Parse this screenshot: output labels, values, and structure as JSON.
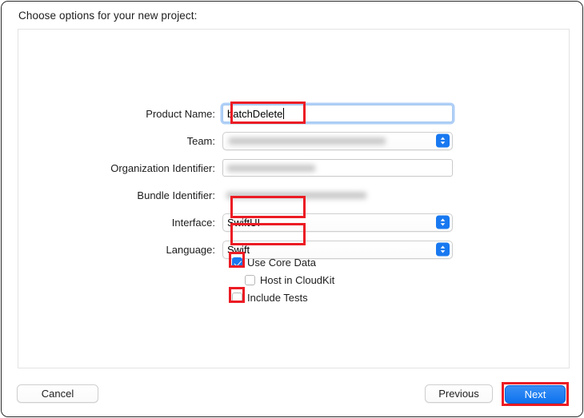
{
  "window": {
    "sheet_title": "Choose options for your new project:"
  },
  "form": {
    "rows": [
      {
        "label": "Product Name:",
        "type": "text",
        "value": "batchDelete",
        "redacted": false,
        "highlighted": true
      },
      {
        "label": "Team:",
        "type": "popup",
        "value": "",
        "redacted": true,
        "highlighted": false
      },
      {
        "label": "Organization Identifier:",
        "type": "plain",
        "value": "",
        "redacted": true,
        "highlighted": false
      },
      {
        "label": "Bundle Identifier:",
        "type": "readonly",
        "value": "",
        "redacted": true,
        "highlighted": false
      },
      {
        "label": "Interface:",
        "type": "popup",
        "value": "SwiftUI",
        "redacted": false,
        "highlighted": true
      },
      {
        "label": "Language:",
        "type": "popup",
        "value": "Swift",
        "redacted": false,
        "highlighted": true
      }
    ]
  },
  "options": {
    "use_core_data": {
      "label": "Use Core Data",
      "checked": true,
      "highlighted": true
    },
    "host_in_cloudkit": {
      "label": "Host in CloudKit",
      "checked": false,
      "highlighted": false
    },
    "include_tests": {
      "label": "Include Tests",
      "checked": false,
      "highlighted": true
    }
  },
  "footer": {
    "cancel_label": "Cancel",
    "previous_label": "Previous",
    "next_label": "Next"
  },
  "colors": {
    "annotation_red": "#EC1C24",
    "accent_blue": "#1878F0",
    "primary_button_blue": "#0D72EE",
    "focus_ring": "#6EA8F0"
  }
}
